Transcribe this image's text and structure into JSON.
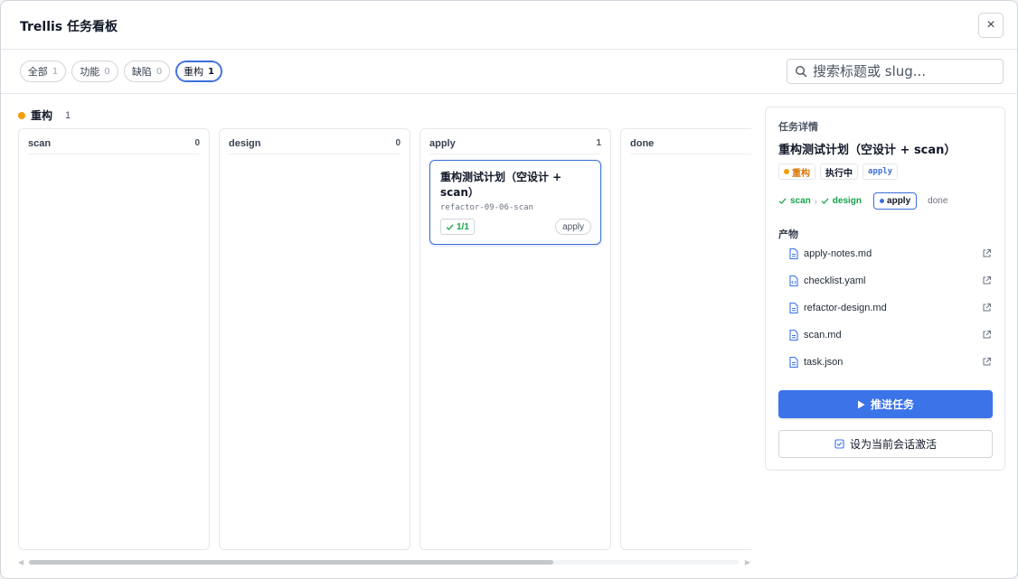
{
  "window": {
    "title": "Trellis 任务看板",
    "close_icon": "×"
  },
  "filters": [
    {
      "label": "全部",
      "count": "1"
    },
    {
      "label": "功能",
      "count": "0"
    },
    {
      "label": "缺陷",
      "count": "0"
    },
    {
      "label": "重构",
      "count": "1",
      "active": true
    }
  ],
  "search": {
    "placeholder": "搜索标题或 slug..."
  },
  "group": {
    "label": "重构",
    "count": "1",
    "color": "#f59e0b"
  },
  "columns": [
    {
      "name": "scan",
      "count": "0"
    },
    {
      "name": "design",
      "count": "0"
    },
    {
      "name": "apply",
      "count": "1"
    },
    {
      "name": "done",
      "count": ""
    }
  ],
  "card": {
    "title": "重构测试计划（空设计 + scan）",
    "slug": "refactor-09-06-scan",
    "progress": "1/1",
    "stage": "apply"
  },
  "detail": {
    "heading": "任务详情",
    "title": "重构测试计划（空设计 + scan）",
    "badges": {
      "tag": "重构",
      "status": "执行中",
      "stage": "apply"
    },
    "pipeline": {
      "done1": "scan",
      "done2": "design",
      "current": "apply",
      "todo": "done"
    },
    "artifacts_label": "产物",
    "artifacts": [
      "apply-notes.md",
      "checklist.yaml",
      "refactor-design.md",
      "scan.md",
      "task.json"
    ],
    "primary_button": "推进任务",
    "secondary_button": "设为当前会话激活"
  },
  "colors": {
    "accent": "#3b73e8",
    "tag": "#f59e0b",
    "success": "#16a34a"
  }
}
